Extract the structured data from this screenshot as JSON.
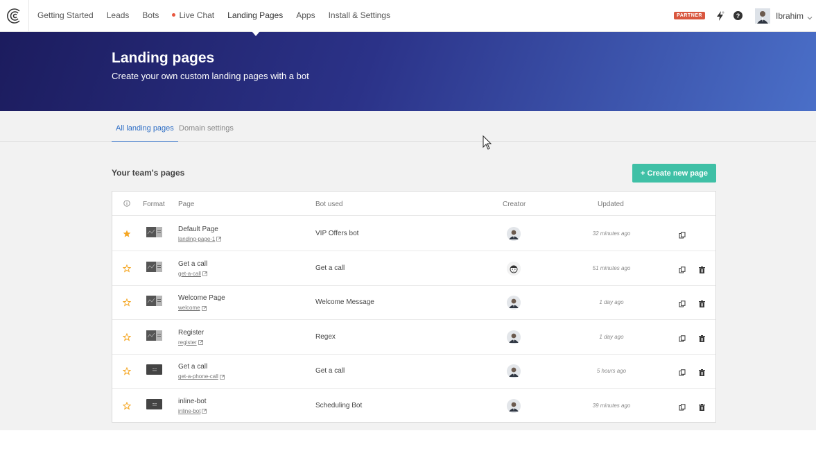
{
  "nav": {
    "links": [
      "Getting Started",
      "Leads",
      "Bots",
      "Live Chat",
      "Landing Pages",
      "Apps",
      "Install & Settings"
    ],
    "active": "Landing Pages",
    "partner_badge": "PARTNER",
    "username": "Ibrahim"
  },
  "hero": {
    "title": "Landing pages",
    "subtitle": "Create your own custom landing pages with a bot"
  },
  "subtabs": [
    "All landing pages",
    "Domain settings"
  ],
  "section": {
    "title": "Your team's pages",
    "create_button": "+ Create new page"
  },
  "table": {
    "headers": {
      "format": "Format",
      "page": "Page",
      "bot": "Bot used",
      "creator": "Creator",
      "updated": "Updated"
    },
    "rows": [
      {
        "starred": true,
        "format": "page",
        "name": "Default Page",
        "slug": "landing-page-1",
        "bot": "VIP Offers bot",
        "creator": "photo",
        "updated": "32 minutes ago",
        "deletable": false
      },
      {
        "starred": false,
        "format": "page",
        "name": "Get a call",
        "slug": "get-a-call",
        "bot": "Get a call",
        "creator": "cartoon",
        "updated": "51 minutes ago",
        "deletable": true
      },
      {
        "starred": false,
        "format": "page",
        "name": "Welcome Page",
        "slug": "welcome",
        "bot": "Welcome Message",
        "creator": "photo",
        "updated": "1 day ago",
        "deletable": true
      },
      {
        "starred": false,
        "format": "page",
        "name": "Register",
        "slug": "register",
        "bot": "Regex",
        "creator": "photo",
        "updated": "1 day ago",
        "deletable": true
      },
      {
        "starred": false,
        "format": "inline",
        "name": "Get a call",
        "slug": "get-a-phone-call",
        "bot": "Get a call",
        "creator": "photo",
        "updated": "5 hours ago",
        "deletable": true
      },
      {
        "starred": false,
        "format": "inline",
        "name": "inline-bot",
        "slug": "inline-bot",
        "bot": "Scheduling Bot",
        "creator": "photo",
        "updated": "39 minutes ago",
        "deletable": true
      }
    ]
  },
  "colors": {
    "accent": "#3fc0a6",
    "link": "#2f6fc6",
    "star": "#f5a623",
    "partner": "#d9573f",
    "hero_start": "#1c1c5e",
    "hero_end": "#4a6fc8"
  },
  "icons": {
    "logo": "landbot-logo-icon",
    "bolt": "lightning-bolt-icon",
    "help": "question-circle-icon",
    "info": "info-icon",
    "star": "star-icon",
    "copy": "copy-icon",
    "trash": "trash-icon",
    "external": "external-link-icon",
    "chevron": "chevron-down-icon",
    "cursor": "mouse-cursor-icon"
  }
}
